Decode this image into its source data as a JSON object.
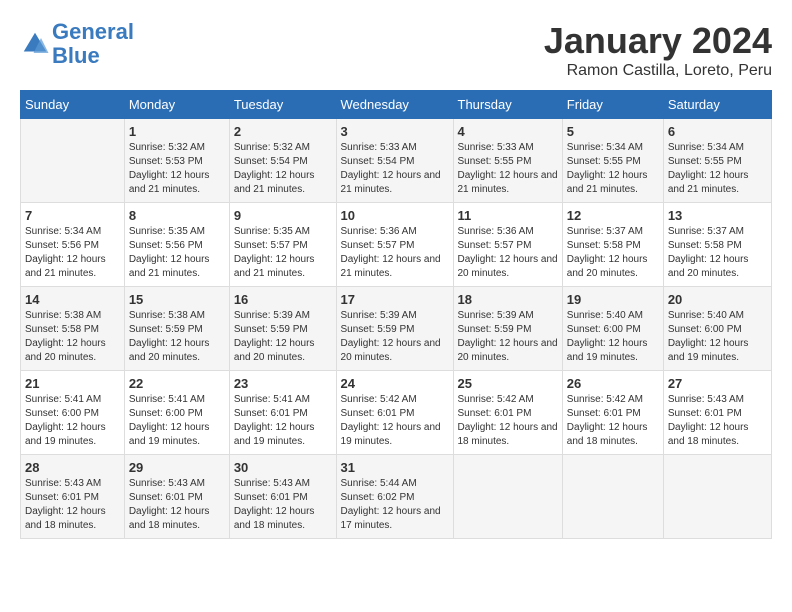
{
  "logo": {
    "text_general": "General",
    "text_blue": "Blue"
  },
  "title": "January 2024",
  "location": "Ramon Castilla, Loreto, Peru",
  "days_of_week": [
    "Sunday",
    "Monday",
    "Tuesday",
    "Wednesday",
    "Thursday",
    "Friday",
    "Saturday"
  ],
  "weeks": [
    [
      {
        "day": "",
        "info": ""
      },
      {
        "day": "1",
        "sunrise": "Sunrise: 5:32 AM",
        "sunset": "Sunset: 5:53 PM",
        "daylight": "Daylight: 12 hours and 21 minutes."
      },
      {
        "day": "2",
        "sunrise": "Sunrise: 5:32 AM",
        "sunset": "Sunset: 5:54 PM",
        "daylight": "Daylight: 12 hours and 21 minutes."
      },
      {
        "day": "3",
        "sunrise": "Sunrise: 5:33 AM",
        "sunset": "Sunset: 5:54 PM",
        "daylight": "Daylight: 12 hours and 21 minutes."
      },
      {
        "day": "4",
        "sunrise": "Sunrise: 5:33 AM",
        "sunset": "Sunset: 5:55 PM",
        "daylight": "Daylight: 12 hours and 21 minutes."
      },
      {
        "day": "5",
        "sunrise": "Sunrise: 5:34 AM",
        "sunset": "Sunset: 5:55 PM",
        "daylight": "Daylight: 12 hours and 21 minutes."
      },
      {
        "day": "6",
        "sunrise": "Sunrise: 5:34 AM",
        "sunset": "Sunset: 5:55 PM",
        "daylight": "Daylight: 12 hours and 21 minutes."
      }
    ],
    [
      {
        "day": "7",
        "sunrise": "Sunrise: 5:34 AM",
        "sunset": "Sunset: 5:56 PM",
        "daylight": "Daylight: 12 hours and 21 minutes."
      },
      {
        "day": "8",
        "sunrise": "Sunrise: 5:35 AM",
        "sunset": "Sunset: 5:56 PM",
        "daylight": "Daylight: 12 hours and 21 minutes."
      },
      {
        "day": "9",
        "sunrise": "Sunrise: 5:35 AM",
        "sunset": "Sunset: 5:57 PM",
        "daylight": "Daylight: 12 hours and 21 minutes."
      },
      {
        "day": "10",
        "sunrise": "Sunrise: 5:36 AM",
        "sunset": "Sunset: 5:57 PM",
        "daylight": "Daylight: 12 hours and 21 minutes."
      },
      {
        "day": "11",
        "sunrise": "Sunrise: 5:36 AM",
        "sunset": "Sunset: 5:57 PM",
        "daylight": "Daylight: 12 hours and 20 minutes."
      },
      {
        "day": "12",
        "sunrise": "Sunrise: 5:37 AM",
        "sunset": "Sunset: 5:58 PM",
        "daylight": "Daylight: 12 hours and 20 minutes."
      },
      {
        "day": "13",
        "sunrise": "Sunrise: 5:37 AM",
        "sunset": "Sunset: 5:58 PM",
        "daylight": "Daylight: 12 hours and 20 minutes."
      }
    ],
    [
      {
        "day": "14",
        "sunrise": "Sunrise: 5:38 AM",
        "sunset": "Sunset: 5:58 PM",
        "daylight": "Daylight: 12 hours and 20 minutes."
      },
      {
        "day": "15",
        "sunrise": "Sunrise: 5:38 AM",
        "sunset": "Sunset: 5:59 PM",
        "daylight": "Daylight: 12 hours and 20 minutes."
      },
      {
        "day": "16",
        "sunrise": "Sunrise: 5:39 AM",
        "sunset": "Sunset: 5:59 PM",
        "daylight": "Daylight: 12 hours and 20 minutes."
      },
      {
        "day": "17",
        "sunrise": "Sunrise: 5:39 AM",
        "sunset": "Sunset: 5:59 PM",
        "daylight": "Daylight: 12 hours and 20 minutes."
      },
      {
        "day": "18",
        "sunrise": "Sunrise: 5:39 AM",
        "sunset": "Sunset: 5:59 PM",
        "daylight": "Daylight: 12 hours and 20 minutes."
      },
      {
        "day": "19",
        "sunrise": "Sunrise: 5:40 AM",
        "sunset": "Sunset: 6:00 PM",
        "daylight": "Daylight: 12 hours and 19 minutes."
      },
      {
        "day": "20",
        "sunrise": "Sunrise: 5:40 AM",
        "sunset": "Sunset: 6:00 PM",
        "daylight": "Daylight: 12 hours and 19 minutes."
      }
    ],
    [
      {
        "day": "21",
        "sunrise": "Sunrise: 5:41 AM",
        "sunset": "Sunset: 6:00 PM",
        "daylight": "Daylight: 12 hours and 19 minutes."
      },
      {
        "day": "22",
        "sunrise": "Sunrise: 5:41 AM",
        "sunset": "Sunset: 6:00 PM",
        "daylight": "Daylight: 12 hours and 19 minutes."
      },
      {
        "day": "23",
        "sunrise": "Sunrise: 5:41 AM",
        "sunset": "Sunset: 6:01 PM",
        "daylight": "Daylight: 12 hours and 19 minutes."
      },
      {
        "day": "24",
        "sunrise": "Sunrise: 5:42 AM",
        "sunset": "Sunset: 6:01 PM",
        "daylight": "Daylight: 12 hours and 19 minutes."
      },
      {
        "day": "25",
        "sunrise": "Sunrise: 5:42 AM",
        "sunset": "Sunset: 6:01 PM",
        "daylight": "Daylight: 12 hours and 18 minutes."
      },
      {
        "day": "26",
        "sunrise": "Sunrise: 5:42 AM",
        "sunset": "Sunset: 6:01 PM",
        "daylight": "Daylight: 12 hours and 18 minutes."
      },
      {
        "day": "27",
        "sunrise": "Sunrise: 5:43 AM",
        "sunset": "Sunset: 6:01 PM",
        "daylight": "Daylight: 12 hours and 18 minutes."
      }
    ],
    [
      {
        "day": "28",
        "sunrise": "Sunrise: 5:43 AM",
        "sunset": "Sunset: 6:01 PM",
        "daylight": "Daylight: 12 hours and 18 minutes."
      },
      {
        "day": "29",
        "sunrise": "Sunrise: 5:43 AM",
        "sunset": "Sunset: 6:01 PM",
        "daylight": "Daylight: 12 hours and 18 minutes."
      },
      {
        "day": "30",
        "sunrise": "Sunrise: 5:43 AM",
        "sunset": "Sunset: 6:01 PM",
        "daylight": "Daylight: 12 hours and 18 minutes."
      },
      {
        "day": "31",
        "sunrise": "Sunrise: 5:44 AM",
        "sunset": "Sunset: 6:02 PM",
        "daylight": "Daylight: 12 hours and 17 minutes."
      },
      {
        "day": "",
        "info": ""
      },
      {
        "day": "",
        "info": ""
      },
      {
        "day": "",
        "info": ""
      }
    ]
  ]
}
